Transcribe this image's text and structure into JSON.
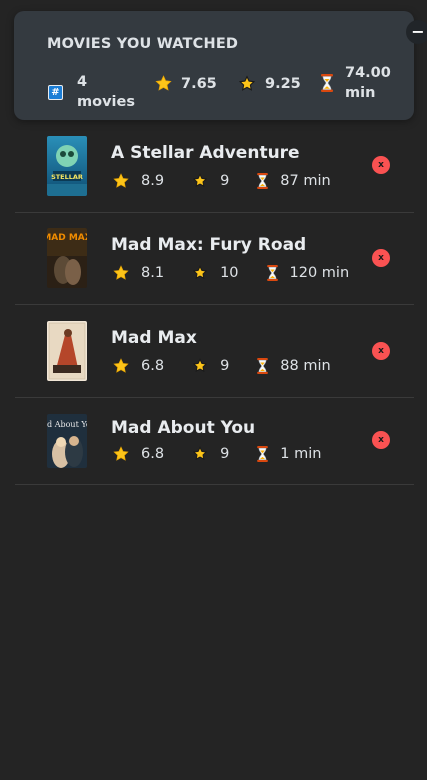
{
  "summary": {
    "title": "MOVIES YOU WATCHED",
    "toggle_label": "−",
    "count_value": "4",
    "count_unit": "movies",
    "avg_imdb_rating": "7.65",
    "avg_user_rating": "9.25",
    "avg_runtime_value": "74.00",
    "avg_runtime_unit": "min"
  },
  "movies": [
    {
      "title": "A Stellar Adventure",
      "imdb_rating": "8.9",
      "user_rating": "9",
      "runtime": "87 min",
      "delete_label": "x"
    },
    {
      "title": "Mad Max: Fury Road",
      "imdb_rating": "8.1",
      "user_rating": "10",
      "runtime": "120 min",
      "delete_label": "x"
    },
    {
      "title": "Mad Max",
      "imdb_rating": "6.8",
      "user_rating": "9",
      "runtime": "88 min",
      "delete_label": "x"
    },
    {
      "title": "Mad About You",
      "imdb_rating": "6.8",
      "user_rating": "9",
      "runtime": "1 min",
      "delete_label": "x"
    }
  ],
  "posters": [
    {
      "caption": "STELLAR"
    },
    {
      "caption": "MAD MAX"
    },
    {
      "caption": ""
    },
    {
      "caption": "Mad About You"
    }
  ],
  "icons": {
    "count": "hash-icon",
    "imdb": "star-icon",
    "user": "glowing-star-icon",
    "runtime": "hourglass-icon"
  },
  "colors": {
    "summary_bg": "#343a40",
    "list_bg": "#242424",
    "delete_button": "#fa5252",
    "star": "#fcc419",
    "hash_badge": "#1c7ed6"
  }
}
